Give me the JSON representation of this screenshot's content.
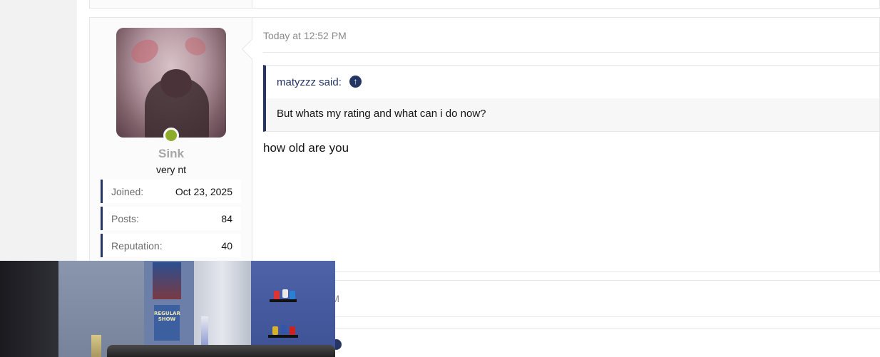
{
  "post": {
    "user": {
      "username": "Sink",
      "user_title": "very nt",
      "online": true,
      "stats": [
        {
          "label": "Joined:",
          "value": "Oct 23, 2025"
        },
        {
          "label": "Posts:",
          "value": "84"
        },
        {
          "label": "Reputation:",
          "value": "40"
        }
      ]
    },
    "date": "Today at 12:52 PM",
    "quote": {
      "author": "matyzzz said:",
      "jump_icon": "arrow-up-circle-icon",
      "text": "But whats my rating and what can i do now?"
    },
    "message": "how old are you"
  },
  "next_post": {
    "date_partial": "PM"
  },
  "webcam": {
    "poster_text": "REGULAR SHOW"
  },
  "colors": {
    "accent": "#253563",
    "online": "#8fab2b",
    "username": "#a6a6a6",
    "muted": "#8a8a8a"
  }
}
